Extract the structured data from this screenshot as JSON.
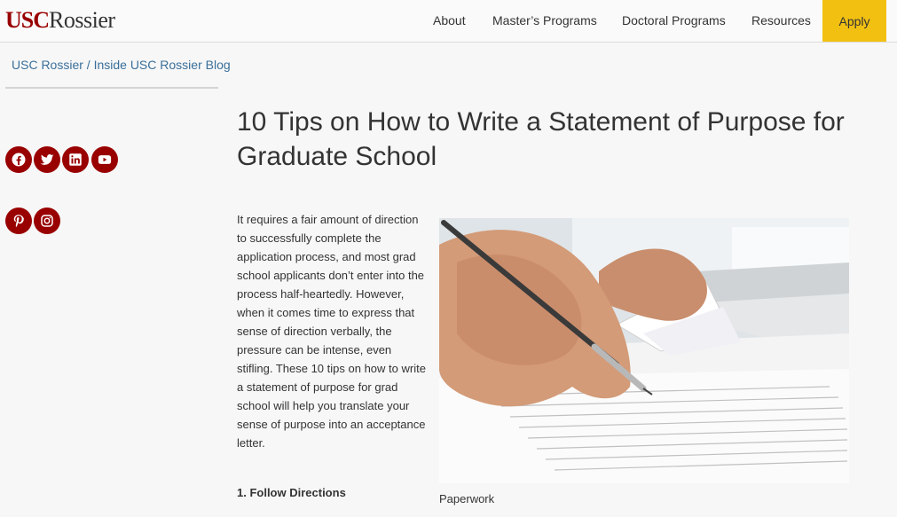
{
  "header": {
    "logo_usc": "USC",
    "logo_rossier": "Rossier",
    "nav": [
      "About",
      "Master’s Programs",
      "Doctoral Programs",
      "Resources"
    ],
    "apply_label": "Apply"
  },
  "breadcrumb": {
    "home": "USC Rossier",
    "separator": " / ",
    "current": "Inside USC Rossier Blog"
  },
  "social_icons": [
    "facebook-icon",
    "twitter-icon",
    "linkedin-icon",
    "youtube-icon",
    "pinterest-icon",
    "instagram-icon"
  ],
  "article": {
    "title": "10 Tips on How to Write a Statement of Purpose for Graduate School",
    "intro": "It requires a fair amount of direction to successfully complete the application process, and most grad school applicants don’t enter into the process half-heartedly. However, when it comes time to express that sense of direction verbally, the pressure can be intense, even stifling. These 10 tips on how to write a statement of purpose for grad school will help you translate your sense of purpose into an acceptance letter.",
    "first_tip": "1. Follow Directions",
    "image_caption": "Paperwork"
  },
  "colors": {
    "brand_red": "#990000",
    "apply_gold": "#f2c011",
    "link_blue": "#3a6f9a"
  }
}
